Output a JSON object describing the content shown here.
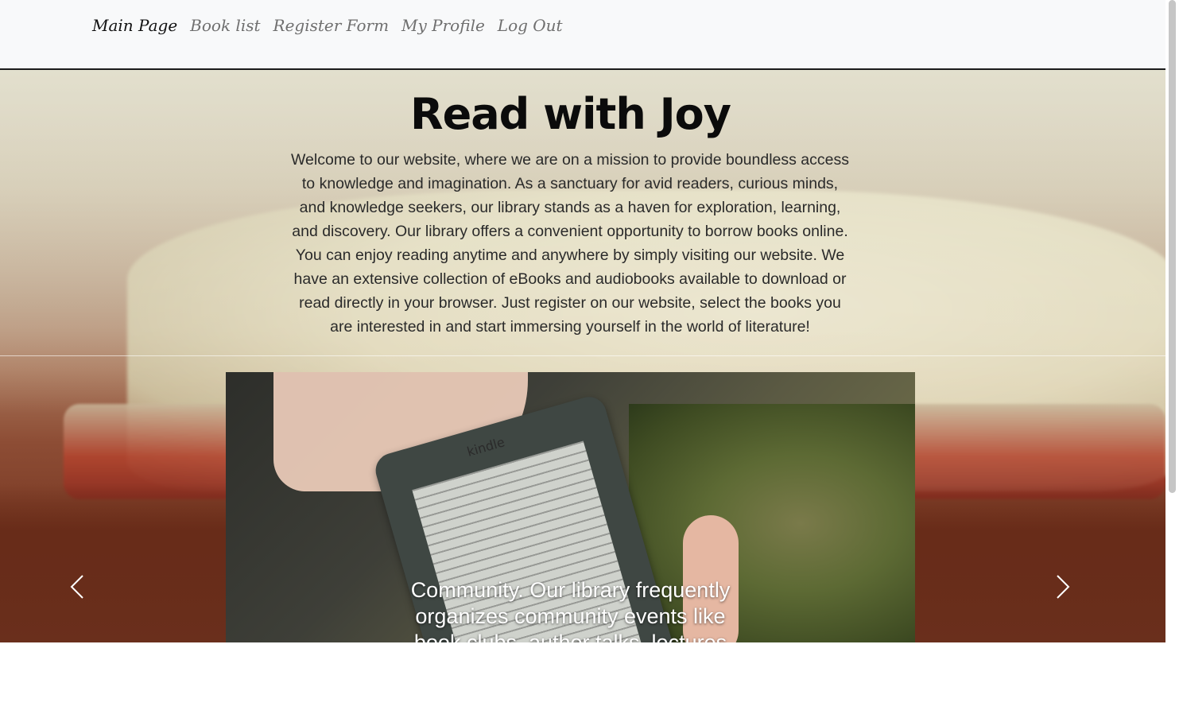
{
  "nav": {
    "items": [
      {
        "label": "Main Page",
        "active": true
      },
      {
        "label": "Book list",
        "active": false
      },
      {
        "label": "Register Form",
        "active": false
      },
      {
        "label": "My Profile",
        "active": false
      },
      {
        "label": "Log Out",
        "active": false
      }
    ]
  },
  "hero": {
    "title": "Read with Joy",
    "text": "Welcome to our website, where we are on a mission to provide boundless access to knowledge and imagination. As a sanctuary for avid readers, curious minds, and knowledge seekers, our library stands as a haven for exploration, learning, and discovery. Our library offers a convenient opportunity to borrow books online. You can enjoy reading anytime and anywhere by simply visiting our website. We have an extensive collection of eBooks and audiobooks available to download or read directly in your browser. Just register on our website, select the books you are interested in and start immersing yourself in the world of literature!"
  },
  "carousel": {
    "caption": "Community. Our library frequently organizes community events like book clubs, author talks, lectures",
    "device_brand": "kindle",
    "prev_icon": "chevron-left-icon",
    "next_icon": "chevron-right-icon"
  },
  "colors": {
    "navbar_bg": "#f8f9fa",
    "nav_active": "#111111",
    "nav_inactive": "#6f6f6f",
    "title": "#0b0b0b"
  }
}
